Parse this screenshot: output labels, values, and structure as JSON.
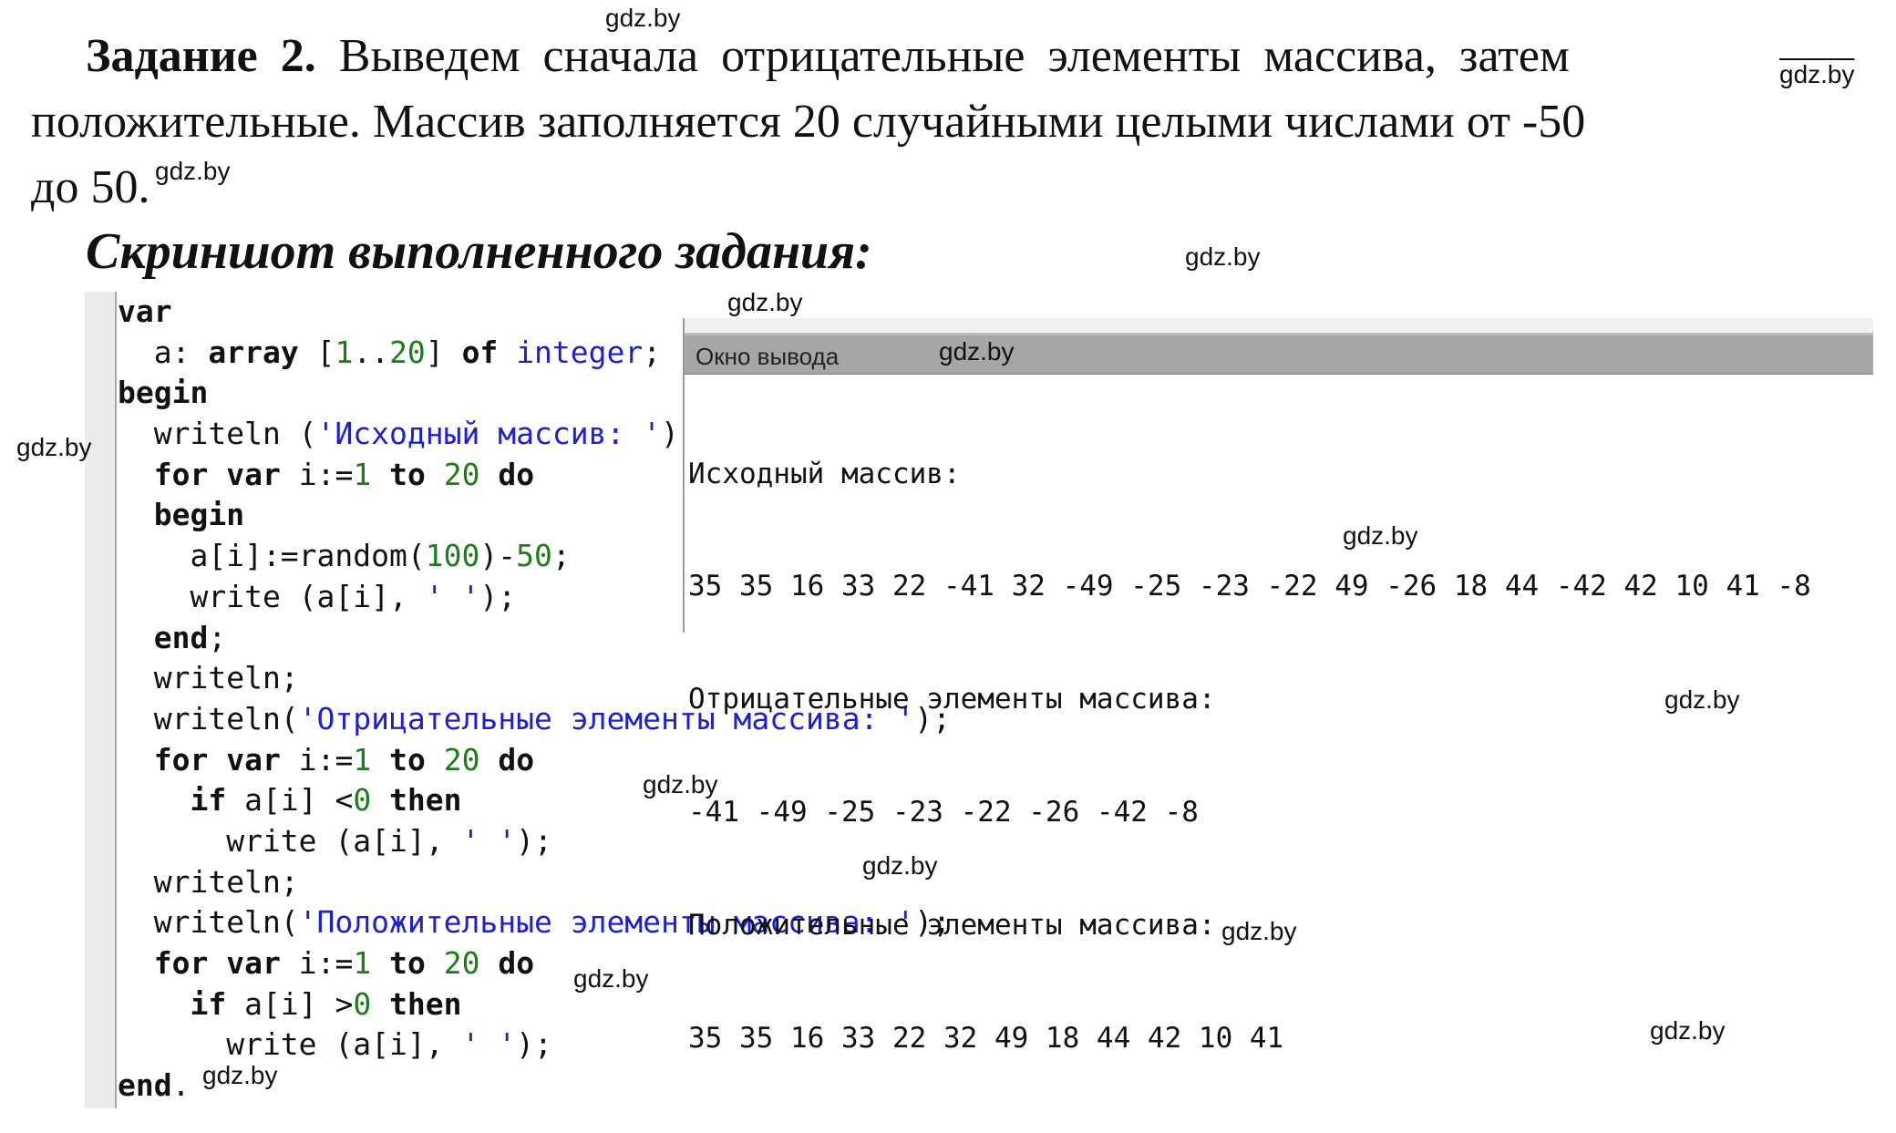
{
  "task": {
    "label": "Задание 2.",
    "line1": "Выведем сначала отрицательные элементы массива, затем",
    "line2": "положительные. Массив заполняется 20 случайными целыми числами от -50",
    "line3": "до 50."
  },
  "subtitle": "Скриншот выполненного задания:",
  "code_lines": [
    [
      {
        "t": "var",
        "c": "kw"
      }
    ],
    [
      {
        "t": "  a: ",
        "c": ""
      },
      {
        "t": "array",
        "c": "kw"
      },
      {
        "t": " [",
        "c": ""
      },
      {
        "t": "1",
        "c": "num"
      },
      {
        "t": "..",
        "c": ""
      },
      {
        "t": "20",
        "c": "num"
      },
      {
        "t": "] ",
        "c": ""
      },
      {
        "t": "of",
        "c": "kw"
      },
      {
        "t": " ",
        "c": ""
      },
      {
        "t": "integer",
        "c": "typ"
      },
      {
        "t": ";",
        "c": ""
      }
    ],
    [
      {
        "t": "begin",
        "c": "kw"
      }
    ],
    [
      {
        "t": "  writeln (",
        "c": ""
      },
      {
        "t": "'Исходный массив: '",
        "c": "str"
      },
      {
        "t": ");",
        "c": ""
      }
    ],
    [
      {
        "t": "  ",
        "c": ""
      },
      {
        "t": "for",
        "c": "kw"
      },
      {
        "t": " ",
        "c": ""
      },
      {
        "t": "var",
        "c": "kw"
      },
      {
        "t": " i:=",
        "c": ""
      },
      {
        "t": "1",
        "c": "num"
      },
      {
        "t": " ",
        "c": ""
      },
      {
        "t": "to",
        "c": "kw"
      },
      {
        "t": " ",
        "c": ""
      },
      {
        "t": "20",
        "c": "num"
      },
      {
        "t": " ",
        "c": ""
      },
      {
        "t": "do",
        "c": "kw"
      }
    ],
    [
      {
        "t": "  ",
        "c": ""
      },
      {
        "t": "begin",
        "c": "kw"
      }
    ],
    [
      {
        "t": "    a[i]:=random(",
        "c": ""
      },
      {
        "t": "100",
        "c": "num"
      },
      {
        "t": ")-",
        "c": ""
      },
      {
        "t": "50",
        "c": "num"
      },
      {
        "t": ";",
        "c": ""
      }
    ],
    [
      {
        "t": "    write (a[i], ",
        "c": ""
      },
      {
        "t": "' '",
        "c": "str"
      },
      {
        "t": ");",
        "c": ""
      }
    ],
    [
      {
        "t": "  ",
        "c": ""
      },
      {
        "t": "end",
        "c": "kw"
      },
      {
        "t": ";",
        "c": ""
      }
    ],
    [
      {
        "t": "  writeln;",
        "c": ""
      }
    ],
    [
      {
        "t": "  writeln(",
        "c": ""
      },
      {
        "t": "'Отрицательные элементы массива: '",
        "c": "str"
      },
      {
        "t": ");",
        "c": ""
      }
    ],
    [
      {
        "t": "  ",
        "c": ""
      },
      {
        "t": "for",
        "c": "kw"
      },
      {
        "t": " ",
        "c": ""
      },
      {
        "t": "var",
        "c": "kw"
      },
      {
        "t": " i:=",
        "c": ""
      },
      {
        "t": "1",
        "c": "num"
      },
      {
        "t": " ",
        "c": ""
      },
      {
        "t": "to",
        "c": "kw"
      },
      {
        "t": " ",
        "c": ""
      },
      {
        "t": "20",
        "c": "num"
      },
      {
        "t": " ",
        "c": ""
      },
      {
        "t": "do",
        "c": "kw"
      }
    ],
    [
      {
        "t": "    ",
        "c": ""
      },
      {
        "t": "if",
        "c": "kw"
      },
      {
        "t": " a[i] <",
        "c": ""
      },
      {
        "t": "0",
        "c": "num"
      },
      {
        "t": " ",
        "c": ""
      },
      {
        "t": "then",
        "c": "kw"
      }
    ],
    [
      {
        "t": "      write (a[i], ",
        "c": ""
      },
      {
        "t": "' '",
        "c": "str"
      },
      {
        "t": ");",
        "c": ""
      }
    ],
    [
      {
        "t": "  writeln;",
        "c": ""
      }
    ],
    [
      {
        "t": "  writeln(",
        "c": ""
      },
      {
        "t": "'Положительные элементы массива: '",
        "c": "str"
      },
      {
        "t": ");",
        "c": ""
      }
    ],
    [
      {
        "t": "  ",
        "c": ""
      },
      {
        "t": "for",
        "c": "kw"
      },
      {
        "t": " ",
        "c": ""
      },
      {
        "t": "var",
        "c": "kw"
      },
      {
        "t": " i:=",
        "c": ""
      },
      {
        "t": "1",
        "c": "num"
      },
      {
        "t": " ",
        "c": ""
      },
      {
        "t": "to",
        "c": "kw"
      },
      {
        "t": " ",
        "c": ""
      },
      {
        "t": "20",
        "c": "num"
      },
      {
        "t": " ",
        "c": ""
      },
      {
        "t": "do",
        "c": "kw"
      }
    ],
    [
      {
        "t": "    ",
        "c": ""
      },
      {
        "t": "if",
        "c": "kw"
      },
      {
        "t": " a[i] >",
        "c": ""
      },
      {
        "t": "0",
        "c": "num"
      },
      {
        "t": " ",
        "c": ""
      },
      {
        "t": "then",
        "c": "kw"
      }
    ],
    [
      {
        "t": "      write (a[i], ",
        "c": ""
      },
      {
        "t": "' '",
        "c": "str"
      },
      {
        "t": ");",
        "c": ""
      }
    ],
    [
      {
        "t": "end",
        "c": "kw"
      },
      {
        "t": ".",
        "c": ""
      }
    ]
  ],
  "output_window": {
    "title": "Окно вывода",
    "lines": [
      "Исходный массив:",
      "35 35 16 33 22 -41 32 -49 -25 -23 -22 49 -26 18 44 -42 42 10 41 -8",
      "Отрицательные элементы массива:",
      "-41 -49 -25 -23 -22 -26 -42 -8",
      "Положительные элементы массива:",
      "35 35 16 33 22 32 49 18 44 42 10 41"
    ]
  },
  "watermark": "gdz.by",
  "colors": {
    "keyword": "#111111",
    "number": "#1d7d1d",
    "string": "#1f1fd0",
    "output_header": "#a6a6a6"
  }
}
